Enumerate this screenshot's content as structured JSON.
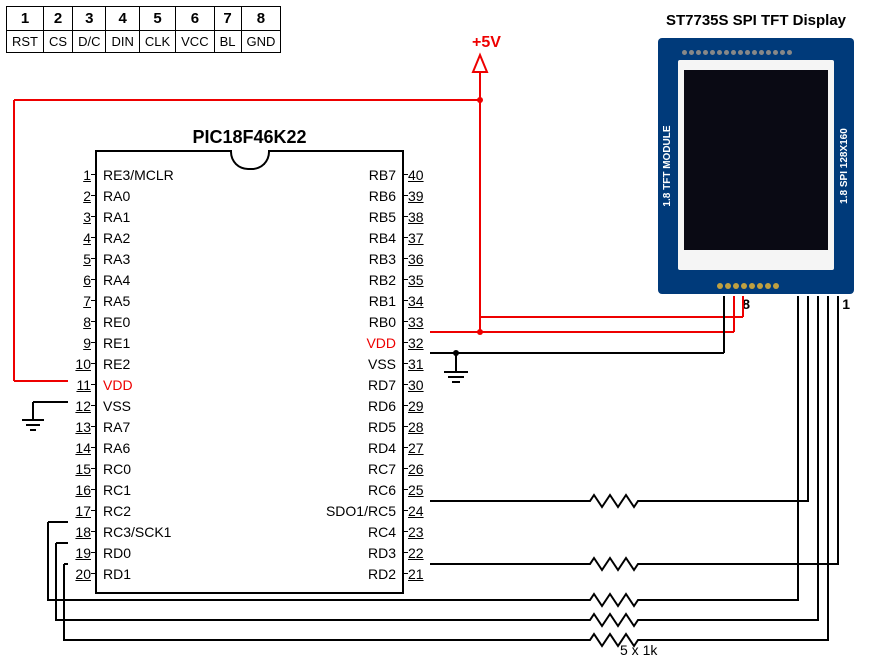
{
  "pinTableHeader": [
    "1",
    "2",
    "3",
    "4",
    "5",
    "6",
    "7",
    "8"
  ],
  "pinTableLabels": [
    "RST",
    "CS",
    "D/C",
    "DIN",
    "CLK",
    "VCC",
    "BL",
    "GND"
  ],
  "chip": {
    "title": "PIC18F46K22",
    "leftPins": [
      {
        "n": "1",
        "l": "RE3/MCLR"
      },
      {
        "n": "2",
        "l": "RA0"
      },
      {
        "n": "3",
        "l": "RA1"
      },
      {
        "n": "4",
        "l": "RA2"
      },
      {
        "n": "5",
        "l": "RA3"
      },
      {
        "n": "6",
        "l": "RA4"
      },
      {
        "n": "7",
        "l": "RA5"
      },
      {
        "n": "8",
        "l": "RE0"
      },
      {
        "n": "9",
        "l": "RE1"
      },
      {
        "n": "10",
        "l": "RE2"
      },
      {
        "n": "11",
        "l": "VDD",
        "red": true
      },
      {
        "n": "12",
        "l": "VSS"
      },
      {
        "n": "13",
        "l": "RA7"
      },
      {
        "n": "14",
        "l": "RA6"
      },
      {
        "n": "15",
        "l": "RC0"
      },
      {
        "n": "16",
        "l": "RC1"
      },
      {
        "n": "17",
        "l": "RC2"
      },
      {
        "n": "18",
        "l": "RC3/SCK1"
      },
      {
        "n": "19",
        "l": "RD0"
      },
      {
        "n": "20",
        "l": "RD1"
      }
    ],
    "rightPins": [
      {
        "n": "40",
        "l": "RB7"
      },
      {
        "n": "39",
        "l": "RB6"
      },
      {
        "n": "38",
        "l": "RB5"
      },
      {
        "n": "37",
        "l": "RB4"
      },
      {
        "n": "36",
        "l": "RB3"
      },
      {
        "n": "35",
        "l": "RB2"
      },
      {
        "n": "34",
        "l": "RB1"
      },
      {
        "n": "33",
        "l": "RB0"
      },
      {
        "n": "32",
        "l": "VDD",
        "red": true
      },
      {
        "n": "31",
        "l": "VSS"
      },
      {
        "n": "30",
        "l": "RD7"
      },
      {
        "n": "29",
        "l": "RD6"
      },
      {
        "n": "28",
        "l": "RD5"
      },
      {
        "n": "27",
        "l": "RD4"
      },
      {
        "n": "26",
        "l": "RC7"
      },
      {
        "n": "25",
        "l": "RC6"
      },
      {
        "n": "24",
        "l": "SDO1/RC5"
      },
      {
        "n": "23",
        "l": "RC4"
      },
      {
        "n": "22",
        "l": "RD3"
      },
      {
        "n": "21",
        "l": "RD2"
      }
    ]
  },
  "voltage": "+5V",
  "display": {
    "title": "ST7735S SPI TFT Display",
    "leftText": "1.8 TFT MODULE",
    "rightText": "1.8 SPI 128X160",
    "pin8": "8",
    "pin1": "1"
  },
  "note": "5 x 1k"
}
